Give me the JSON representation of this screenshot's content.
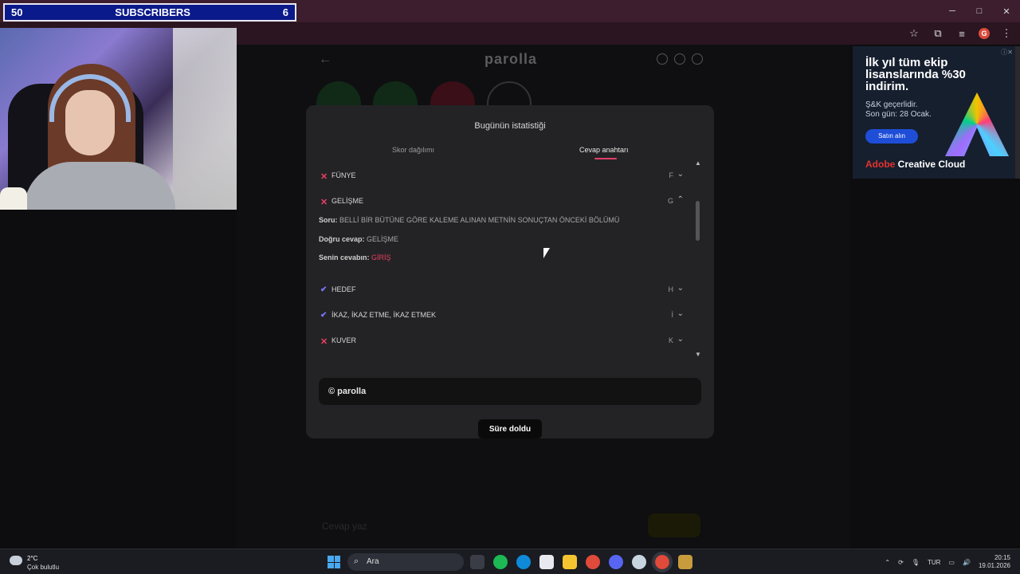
{
  "stream_overlay": {
    "left_count": "50",
    "label": "SUBSCRIBERS",
    "right_count": "6"
  },
  "browser": {
    "window_controls": {
      "minimize": "─",
      "maximize": "□",
      "close": "✕"
    },
    "toolbar_icons": [
      "star-icon",
      "extensions-icon",
      "media-icon",
      "profile-avatar",
      "menu-icon"
    ],
    "profile_initial": "G"
  },
  "game": {
    "logo": "parolla",
    "header_icons": [
      "info-icon",
      "stats-icon",
      "account-icon"
    ],
    "bottom_placeholder": "Cevap yaz"
  },
  "modal": {
    "title": "Bugünün istatistiği",
    "tabs": [
      {
        "label": "Skor dağılımı",
        "active": false
      },
      {
        "label": "Cevap anahtarı",
        "active": true
      }
    ],
    "rows": [
      {
        "status": "wrong",
        "word": "FÜNYE",
        "letter": "F",
        "expanded": false
      },
      {
        "status": "wrong",
        "word": "GELİŞME",
        "letter": "G",
        "expanded": true
      },
      {
        "status": "correct",
        "word": "HEDEF",
        "letter": "H",
        "expanded": false
      },
      {
        "status": "correct",
        "word": "İKAZ, İKAZ ETME, İKAZ ETMEK",
        "letter": "İ",
        "expanded": false
      },
      {
        "status": "wrong",
        "word": "KUVER",
        "letter": "K",
        "expanded": false
      }
    ],
    "detail": {
      "question_label": "Soru:",
      "question": "BELLİ BİR BÜTÜNE GÖRE KALEME ALINAN METNİN SONUÇTAN ÖNCEKİ BÖLÜMÜ",
      "correct_label": "Doğru cevap:",
      "correct": "GELİŞME",
      "yours_label": "Senin cevabın:",
      "yours": "GİRİŞ"
    },
    "share_text": "© parolla",
    "timeout_button": "Süre doldu",
    "colors": {
      "wrong": "#ea3f63",
      "correct": "#7a76ff",
      "accent": "#e0406a"
    }
  },
  "ad": {
    "headline": "İlk yıl tüm ekip lisanslarında %30 indirim.",
    "line1": "Ş&K geçerlidir.",
    "line2": "Son gün: 28 Ocak.",
    "button": "Satın alın",
    "brand_red": "Adobe",
    "brand": " Creative Cloud"
  },
  "taskbar": {
    "weather_temp": "2°C",
    "weather_cond": "Çok bulutlu",
    "weather_badge": "1",
    "search_placeholder": "Ara",
    "apps": [
      "task-view-icon",
      "spotify-icon",
      "edge-icon",
      "store-icon",
      "explorer-icon",
      "chrome-icon",
      "discord-icon",
      "steam-icon",
      "chrome-active-icon",
      "lol-icon"
    ],
    "lang": "TUR",
    "time": "20:15",
    "date": "19.01.2026"
  }
}
